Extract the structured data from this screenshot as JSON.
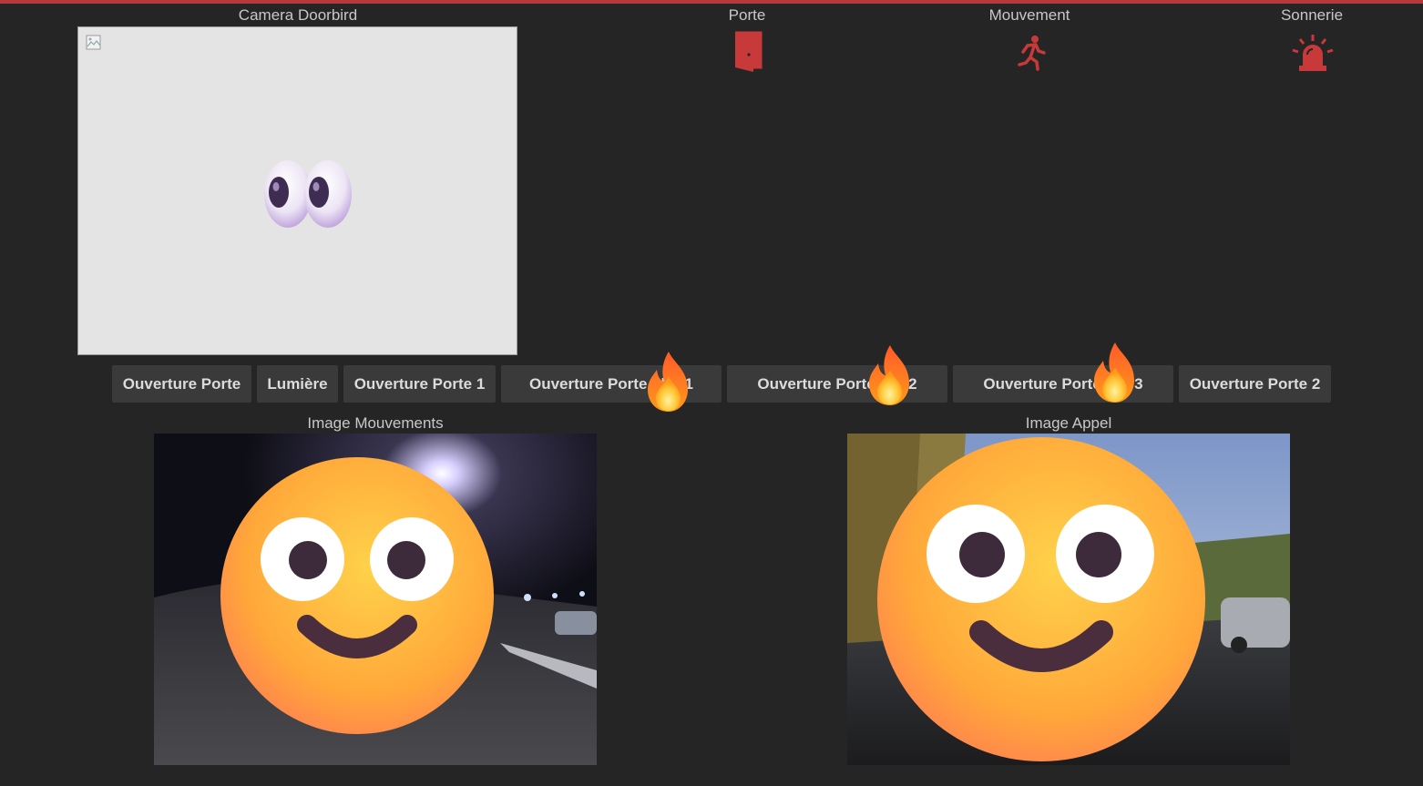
{
  "tiles": {
    "camera": {
      "label": "Camera Doorbird"
    },
    "door": {
      "label": "Porte",
      "icon": "door-icon"
    },
    "motion": {
      "label": "Mouvement",
      "icon": "running-person-icon"
    },
    "ring": {
      "label": "Sonnerie",
      "icon": "siren-icon"
    }
  },
  "buttons": [
    {
      "label": "Ouverture Porte"
    },
    {
      "label": "Lumière"
    },
    {
      "label": "Ouverture Porte 1"
    },
    {
      "label": "Ouverture Porte gl   @1"
    },
    {
      "label": "Ouverture Porte g   @2"
    },
    {
      "label": "Ouverture Porte g   @3"
    },
    {
      "label": "Ouverture Porte 2"
    }
  ],
  "images": {
    "motion": {
      "label": "Image Mouvements"
    },
    "call": {
      "label": "Image Appel"
    }
  },
  "colors": {
    "accent": "#b5393a",
    "background": "#252525",
    "button": "#3a3a3a"
  }
}
